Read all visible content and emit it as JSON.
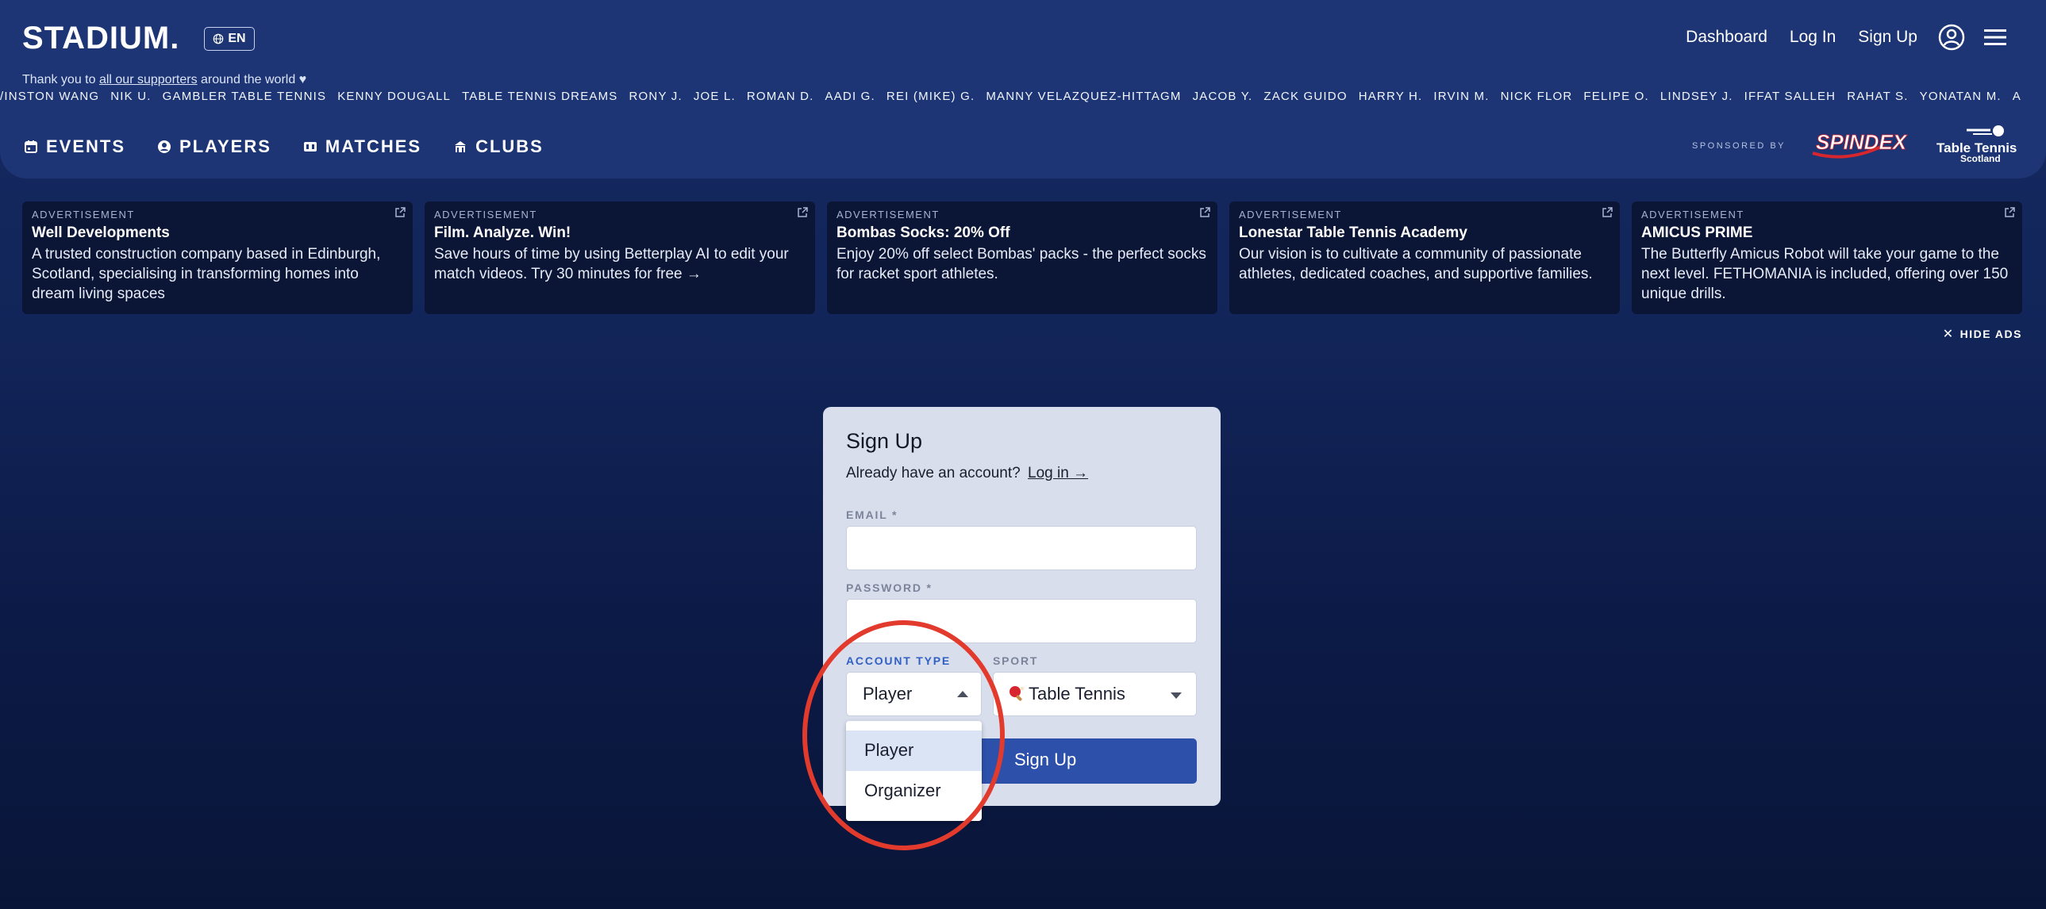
{
  "header": {
    "logo": "STADIUM.",
    "lang": "EN",
    "nav": {
      "dashboard": "Dashboard",
      "login": "Log In",
      "signup": "Sign Up"
    },
    "thanks_prefix": "Thank you to",
    "thanks_link": "all our supporters",
    "thanks_suffix": "around the world ♥",
    "supporters": [
      "/INSTON WANG",
      "NIK U.",
      "GAMBLER TABLE TENNIS",
      "KENNY DOUGALL",
      "TABLE TENNIS DREAMS",
      "RONY J.",
      "JOE L.",
      "ROMAN D.",
      "AADI G.",
      "REI (MIKE) G.",
      "MANNY VELAZQUEZ-HITTAGM",
      "JACOB Y.",
      "ZACK GUIDO",
      "HARRY H.",
      "IRVIN M.",
      "NICK FLOR",
      "FELIPE O.",
      "LINDSEY J.",
      "IFFAT SALLEH",
      "RAHAT S.",
      "YONATAN M.",
      "A"
    ]
  },
  "main_nav": {
    "events": "EVENTS",
    "players": "PLAYERS",
    "matches": "MATCHES",
    "clubs": "CLUBS"
  },
  "sponsors": {
    "label": "SPONSORED BY",
    "spindex": "SPINDEX",
    "tts_line1": "Table Tennis",
    "tts_line2": "Scotland"
  },
  "ads": [
    {
      "label": "ADVERTISEMENT",
      "title": "Well Developments",
      "body": "A trusted construction company based in Edinburgh, Scotland, specialising in transforming homes into dream living spaces"
    },
    {
      "label": "ADVERTISEMENT",
      "title": "Film. Analyze. Win!",
      "body": "Save hours of time by using Betterplay AI to edit your match videos. Try 30 minutes for free →"
    },
    {
      "label": "ADVERTISEMENT",
      "title": "Bombas Socks: 20% Off",
      "body": "Enjoy 20% off select Bombas' packs - the perfect socks for racket sport athletes."
    },
    {
      "label": "ADVERTISEMENT",
      "title": "Lonestar Table Tennis Academy",
      "body": "Our vision is to cultivate a community of passionate athletes, dedicated coaches, and supportive families."
    },
    {
      "label": "ADVERTISEMENT",
      "title": "AMICUS PRIME",
      "body": "The Butterfly Amicus Robot will take your game to the next level. FETHOMANIA is included, offering over 150 unique drills."
    }
  ],
  "hide_ads": "HIDE ADS",
  "signup_form": {
    "title": "Sign Up",
    "have_account": "Already have an account?",
    "login_link": "Log in →",
    "email_label": "EMAIL *",
    "email_value": "",
    "password_label": "PASSWORD *",
    "password_value": "",
    "account_type_label": "ACCOUNT TYPE",
    "account_type_value": "Player",
    "sport_label": "SPORT",
    "sport_value": "Table Tennis",
    "submit": "Sign Up",
    "account_type_options": [
      "Player",
      "Organizer"
    ]
  },
  "colors": {
    "accent": "#2d50aa",
    "highlight_circle": "#e23a2c",
    "active_label": "#3160c4"
  }
}
